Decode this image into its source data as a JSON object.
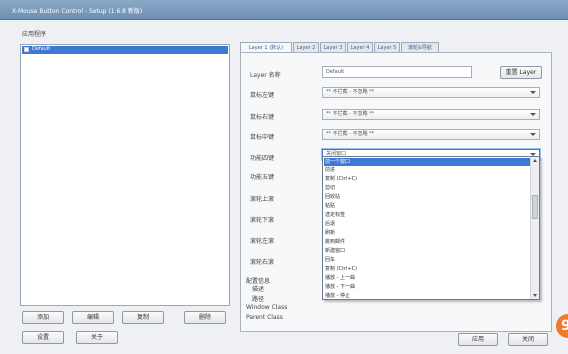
{
  "window": {
    "title": "X-Mouse Button Control - Setup (1.6.8 新版)",
    "title_box": "(新版)"
  },
  "apps": {
    "heading": "应用程序",
    "items": [
      {
        "label": "Default",
        "checked": true,
        "selected": true
      }
    ]
  },
  "left_buttons": {
    "add": "添加",
    "edit": "编辑",
    "copy": "复制",
    "delete": "删除",
    "settings": "设置",
    "about": "关于"
  },
  "tabs": [
    "Layer 1 (默认)",
    "Layer 2",
    "Layer 3",
    "Layer 4",
    "Layer 5",
    "滚轮&导航"
  ],
  "layer": {
    "name_label": "Layer 名称",
    "name_value": "Default",
    "rename_button": "重置 Layer"
  },
  "buttons": [
    {
      "label": "鼠标左键",
      "value": "** 不拦截 - 不忽略 **"
    },
    {
      "label": "鼠标右键",
      "value": "** 不拦截 - 不忽略 **"
    },
    {
      "label": "鼠标中键",
      "value": "** 不拦截 - 不忽略 **"
    },
    {
      "label": "功能四键",
      "value": "关闭窗口"
    },
    {
      "label": "功能五键",
      "value": ""
    },
    {
      "label": "滚轮上滚",
      "value": ""
    },
    {
      "label": "滚轮下滚",
      "value": ""
    },
    {
      "label": "滚轮左滚",
      "value": ""
    },
    {
      "label": "滚轮右滚",
      "value": ""
    }
  ],
  "dropdown": {
    "items": [
      "前一个窗口",
      "前进",
      "复制 (Ctrl+C)",
      "剪切",
      "回收站",
      "粘贴",
      "选定标签",
      "后退",
      "刷新",
      "跳到邮件",
      "新建窗口",
      "回车",
      "复制 (Ctrl+C)",
      "播放 - 上一曲",
      "播放 - 下一曲",
      "播放 - 停止"
    ],
    "selected_index": 0
  },
  "profile": {
    "heading": "配置信息",
    "desc_label": "描述",
    "path_label": "路径",
    "window_class_label": "Window Class",
    "parent_class_label": "Parent Class"
  },
  "dialog_buttons": {
    "apply": "应用",
    "close": "关闭"
  },
  "badge": "9",
  "colors": {
    "accent": "#3d78d4",
    "badge": "#f07a2a"
  }
}
